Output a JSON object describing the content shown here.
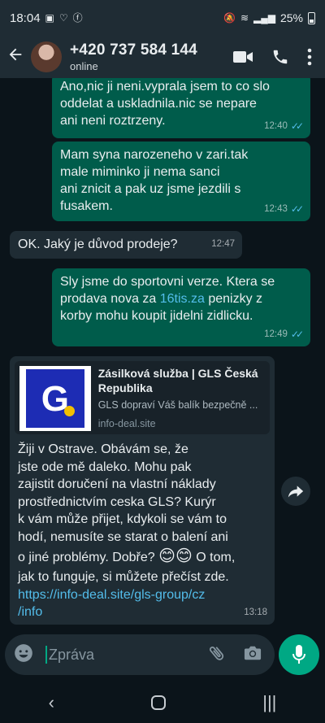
{
  "status_bar": {
    "time": "18:04",
    "battery": "25%"
  },
  "header": {
    "contact_name": "+420 737 584 144",
    "presence": "online"
  },
  "messages": [
    {
      "direction": "out",
      "lines": [
        "Ano,nic ji neni.vyprala jsem to co slo",
        "oddelat a uskladnila.nic se nepare",
        "ani neni roztrzeny."
      ],
      "time": "12:40",
      "read": true
    },
    {
      "direction": "out",
      "lines": [
        "Mam syna narozeneho v zari.tak",
        "male miminko ji nema sanci",
        "ani znicit a pak uz jsme jezdili s",
        "fusakem."
      ],
      "time": "12:43",
      "read": true
    },
    {
      "direction": "in",
      "lines": [
        "OK. Jaký je důvod prodeje?"
      ],
      "time": "12:47"
    },
    {
      "direction": "out",
      "line1": "Sly jsme do sportovni verze. Ktera se",
      "line2_prefix": "prodava nova za ",
      "line2_link": "16tis.za",
      "line2_suffix": " penizky z",
      "line3": "korby mohu koupit jidelni zidlicku.",
      "time": "12:49",
      "read": true
    },
    {
      "direction": "in",
      "preview": {
        "title_line1": "Zásilková služba | GLS Česká",
        "title_line2": "Republika",
        "description": "GLS dopraví Váš balík bezpečně ...",
        "domain": "info-deal.site",
        "logo_letter": "G"
      },
      "lines": [
        "Žiji v Ostrave.  Obávám se, že",
        "jste ode mě daleko. Mohu pak",
        "zajistit doručení na vlastní náklady",
        "prostřednictvím ceska GLS?  Kurýr",
        "k vám může přijet, kdykoli se vám to",
        "hodí, nemusíte se starat o balení ani"
      ],
      "emoji_line_prefix": "o jiné problémy. Dobře? ",
      "emojis": "😊😊",
      "emoji_line_suffix": " O tom,",
      "line_after": "jak to funguje, si můžete přečíst zde.",
      "link_line1": "https://info-deal.site/gls-group/cz",
      "link_line2": "/info",
      "time": "13:18"
    }
  ],
  "input": {
    "placeholder": "Zpráva"
  },
  "colors": {
    "outgoing": "#005c4b",
    "incoming": "#1f2c34",
    "accent": "#00a884",
    "link": "#53bdeb"
  },
  "icons": [
    "back-arrow-icon",
    "video-call-icon",
    "phone-icon",
    "more-icon",
    "emoji-icon",
    "attach-icon",
    "camera-icon",
    "mic-icon",
    "forward-icon"
  ]
}
